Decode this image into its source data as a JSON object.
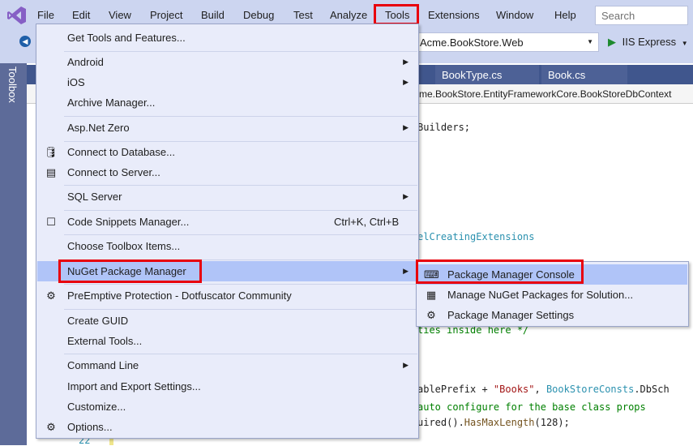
{
  "menubar": {
    "items": [
      "File",
      "Edit",
      "View",
      "Project",
      "Build",
      "Debug",
      "Test",
      "Analyze",
      "Tools",
      "Extensions",
      "Window",
      "Help"
    ],
    "search_placeholder": "Search",
    "highlighted": "Tools"
  },
  "toolbar": {
    "startup_project": "Acme.BookStore.Web",
    "run_label": "IIS Express"
  },
  "toolbox_label": "Toolbox",
  "tabs": [
    "BookType.cs",
    "Book.cs"
  ],
  "navbar": {
    "scope": "Acme.BookStore.EntityFrameworkCore.BookStoreDbContext"
  },
  "code_lines": [
    "Builders;",
    "elCreatingExtensions",
    "ties inside here */",
    "ablePrefix + ",
    "\"Books\"",
    ", ",
    "BookStoreConsts",
    ".DbSch",
    "auto configure for the base class props",
    "uired().",
    "HasMaxLength",
    "(128);"
  ],
  "line_number": "22",
  "tools_menu": [
    {
      "label": "Get Tools and Features..."
    },
    {
      "label": "Android",
      "submenu": true
    },
    {
      "label": "iOS",
      "submenu": true
    },
    {
      "label": "Archive Manager..."
    },
    {
      "label": "Asp.Net Zero",
      "submenu": true
    },
    {
      "label": "Connect to Database...",
      "icon": "database-icon"
    },
    {
      "label": "Connect to Server...",
      "icon": "server-icon"
    },
    {
      "label": "SQL Server",
      "submenu": true
    },
    {
      "label": "Code Snippets Manager...",
      "shortcut": "Ctrl+K, Ctrl+B",
      "icon": "snippet-icon"
    },
    {
      "label": "Choose Toolbox Items..."
    },
    {
      "label": "NuGet Package Manager",
      "submenu": true,
      "selected": true
    },
    {
      "label": "PreEmptive Protection - Dotfuscator Community",
      "icon": "preemptive-icon"
    },
    {
      "label": "Create GUID"
    },
    {
      "label": "External Tools..."
    },
    {
      "label": "Command Line",
      "submenu": true
    },
    {
      "label": "Import and Export Settings..."
    },
    {
      "label": "Customize..."
    },
    {
      "label": "Options...",
      "icon": "gear-icon"
    }
  ],
  "nuget_submenu": [
    {
      "label": "Package Manager Console",
      "icon": "console-icon",
      "selected": true
    },
    {
      "label": "Manage NuGet Packages for Solution...",
      "icon": "package-icon"
    },
    {
      "label": "Package Manager Settings",
      "icon": "gear-icon"
    }
  ],
  "colors": {
    "highlight_box": "#e8000c",
    "menu_bg": "#e9ecfa",
    "selected_bg": "#b0c4f8",
    "vs_purple": "#865fc5"
  }
}
